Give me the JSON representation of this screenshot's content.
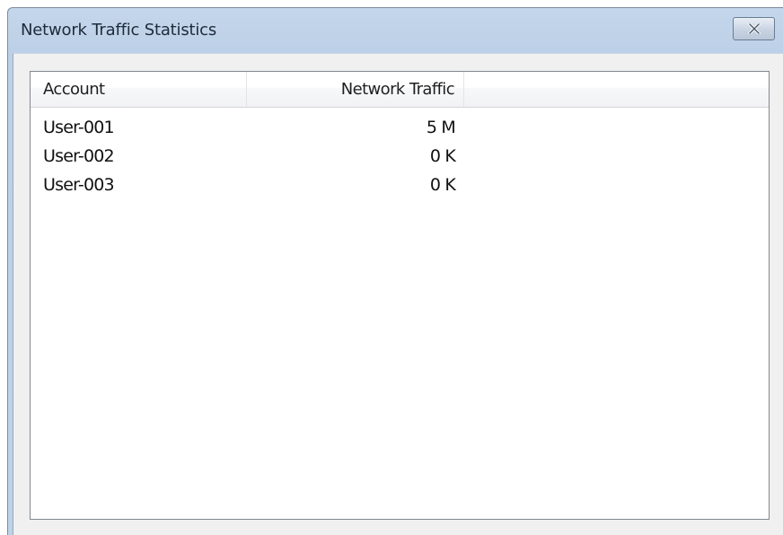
{
  "window": {
    "title": "Network Traffic Statistics",
    "close_icon": "close-x-icon"
  },
  "list": {
    "columns": [
      "Account",
      "Network Traffic"
    ],
    "rows": [
      {
        "account": "User-001",
        "traffic": "5 M"
      },
      {
        "account": "User-002",
        "traffic": "0 K"
      },
      {
        "account": "User-003",
        "traffic": "0 K"
      }
    ]
  },
  "colors": {
    "titlebar": "#bed2e8",
    "client_background": "#f0f0f0",
    "list_background": "#ffffff"
  }
}
